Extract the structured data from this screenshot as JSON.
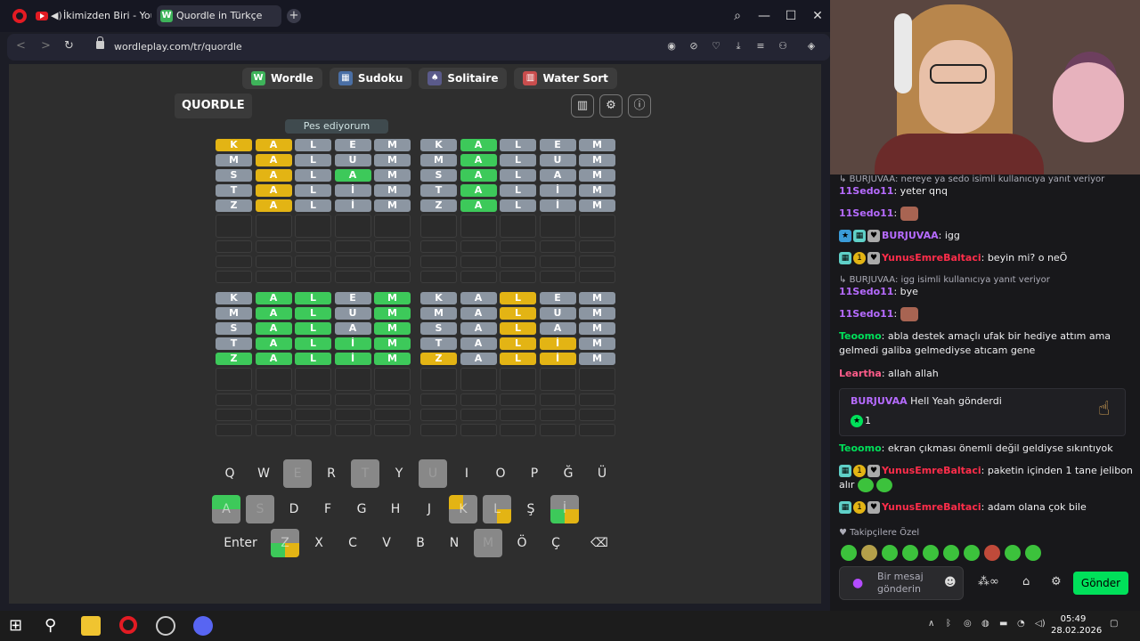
{
  "browser": {
    "tabs": [
      {
        "label": "İkimizden Biri - YouTube"
      },
      {
        "label": "Quordle in Türkçe"
      }
    ],
    "url": "wordleplay.com/tr/quordle"
  },
  "site_nav": [
    {
      "label": "Wordle",
      "icon": "wordle-icon",
      "color": "#3eb35a"
    },
    {
      "label": "Sudoku",
      "icon": "sudoku-grid-icon",
      "color": "#4a6fa5"
    },
    {
      "label": "Solitaire",
      "icon": "cards-icon",
      "color": "#5a5a8a"
    },
    {
      "label": "Water Sort",
      "icon": "tubes-icon",
      "color": "#c94d4d"
    }
  ],
  "game": {
    "title": "QUORDLE",
    "give_up": "Pes ediyorum",
    "boards": [
      {
        "rows": [
          [
            [
              "K",
              "y"
            ],
            [
              "A",
              "y"
            ],
            [
              "L",
              "x"
            ],
            [
              "E",
              "x"
            ],
            [
              "M",
              "x"
            ]
          ],
          [
            [
              "M",
              "x"
            ],
            [
              "A",
              "y"
            ],
            [
              "L",
              "x"
            ],
            [
              "U",
              "x"
            ],
            [
              "M",
              "x"
            ]
          ],
          [
            [
              "S",
              "x"
            ],
            [
              "A",
              "y"
            ],
            [
              "L",
              "x"
            ],
            [
              "A",
              "g"
            ],
            [
              "M",
              "x"
            ]
          ],
          [
            [
              "T",
              "x"
            ],
            [
              "A",
              "y"
            ],
            [
              "L",
              "x"
            ],
            [
              "İ",
              "x"
            ],
            [
              "M",
              "x"
            ]
          ],
          [
            [
              "Z",
              "x"
            ],
            [
              "A",
              "y"
            ],
            [
              "L",
              "x"
            ],
            [
              "İ",
              "x"
            ],
            [
              "M",
              "x"
            ]
          ]
        ]
      },
      {
        "rows": [
          [
            [
              "K",
              "x"
            ],
            [
              "A",
              "g"
            ],
            [
              "L",
              "x"
            ],
            [
              "E",
              "x"
            ],
            [
              "M",
              "x"
            ]
          ],
          [
            [
              "M",
              "x"
            ],
            [
              "A",
              "g"
            ],
            [
              "L",
              "x"
            ],
            [
              "U",
              "x"
            ],
            [
              "M",
              "x"
            ]
          ],
          [
            [
              "S",
              "x"
            ],
            [
              "A",
              "g"
            ],
            [
              "L",
              "x"
            ],
            [
              "A",
              "x"
            ],
            [
              "M",
              "x"
            ]
          ],
          [
            [
              "T",
              "x"
            ],
            [
              "A",
              "g"
            ],
            [
              "L",
              "x"
            ],
            [
              "İ",
              "x"
            ],
            [
              "M",
              "x"
            ]
          ],
          [
            [
              "Z",
              "x"
            ],
            [
              "A",
              "g"
            ],
            [
              "L",
              "x"
            ],
            [
              "İ",
              "x"
            ],
            [
              "M",
              "x"
            ]
          ]
        ]
      },
      {
        "rows": [
          [
            [
              "K",
              "x"
            ],
            [
              "A",
              "g"
            ],
            [
              "L",
              "g"
            ],
            [
              "E",
              "x"
            ],
            [
              "M",
              "g"
            ]
          ],
          [
            [
              "M",
              "x"
            ],
            [
              "A",
              "g"
            ],
            [
              "L",
              "g"
            ],
            [
              "U",
              "x"
            ],
            [
              "M",
              "g"
            ]
          ],
          [
            [
              "S",
              "x"
            ],
            [
              "A",
              "g"
            ],
            [
              "L",
              "g"
            ],
            [
              "A",
              "x"
            ],
            [
              "M",
              "g"
            ]
          ],
          [
            [
              "T",
              "x"
            ],
            [
              "A",
              "g"
            ],
            [
              "L",
              "g"
            ],
            [
              "İ",
              "g"
            ],
            [
              "M",
              "g"
            ]
          ],
          [
            [
              "Z",
              "g"
            ],
            [
              "A",
              "g"
            ],
            [
              "L",
              "g"
            ],
            [
              "İ",
              "g"
            ],
            [
              "M",
              "g"
            ]
          ]
        ]
      },
      {
        "rows": [
          [
            [
              "K",
              "x"
            ],
            [
              "A",
              "x"
            ],
            [
              "L",
              "y"
            ],
            [
              "E",
              "x"
            ],
            [
              "M",
              "x"
            ]
          ],
          [
            [
              "M",
              "x"
            ],
            [
              "A",
              "x"
            ],
            [
              "L",
              "y"
            ],
            [
              "U",
              "x"
            ],
            [
              "M",
              "x"
            ]
          ],
          [
            [
              "S",
              "x"
            ],
            [
              "A",
              "x"
            ],
            [
              "L",
              "y"
            ],
            [
              "A",
              "x"
            ],
            [
              "M",
              "x"
            ]
          ],
          [
            [
              "T",
              "x"
            ],
            [
              "A",
              "x"
            ],
            [
              "L",
              "y"
            ],
            [
              "İ",
              "y"
            ],
            [
              "M",
              "x"
            ]
          ],
          [
            [
              "Z",
              "y"
            ],
            [
              "A",
              "x"
            ],
            [
              "L",
              "y"
            ],
            [
              "İ",
              "y"
            ],
            [
              "M",
              "x"
            ]
          ]
        ]
      }
    ],
    "keyboard": {
      "row1": [
        "Q",
        "W",
        "E",
        "R",
        "T",
        "Y",
        "U",
        "I",
        "O",
        "P",
        "Ğ",
        "Ü"
      ],
      "row2": [
        "A",
        "S",
        "D",
        "F",
        "G",
        "H",
        "J",
        "K",
        "L",
        "Ş",
        "İ"
      ],
      "row3": [
        "Enter",
        "Z",
        "X",
        "C",
        "V",
        "B",
        "N",
        "M",
        "Ö",
        "Ç",
        "⌫"
      ],
      "used": [
        "E",
        "T",
        "U",
        "S",
        "M"
      ],
      "split_keys": {
        "A": [
          "#3dc95a",
          "#3dc95a",
          "#888",
          "#888"
        ],
        "K": [
          "#e3b414",
          "#888",
          "#888",
          "#888"
        ],
        "L": [
          "#888",
          "#888",
          "#888",
          "#e3b414"
        ],
        "İ": [
          "#888",
          "#888",
          "#3dc95a",
          "#e3b414"
        ],
        "Z": [
          "#888",
          "#888",
          "#3dc95a",
          "#e3b414"
        ]
      }
    }
  },
  "chat": {
    "messages": [
      {
        "reply": "BURJUVAA: nereye ya sedo isimli kullanıcıya yanıt veriyor"
      },
      {
        "user": "11Sedo11",
        "text": "yeter qnq"
      },
      {
        "user": "11Sedo11",
        "text": "",
        "emote": true
      },
      {
        "user": "BURJUVAA",
        "text": "igg"
      },
      {
        "user": "YunusEmreBaltaci",
        "text": "beyin mi? o neÖ"
      },
      {
        "reply": "BURJUVAA: igg isimli kullanıcıya yanıt veriyor"
      },
      {
        "user": "11Sedo11",
        "text": "bye"
      },
      {
        "user": "11Sedo11",
        "text": "",
        "emote": true
      },
      {
        "user": "Teoomo",
        "text": "abla destek amaçlı ufak bir hediye attım ama gelmedi galiba gelmediyse atıcam gene"
      },
      {
        "user": "Leartha",
        "text": "allah allah"
      },
      {
        "user": "Teoomo",
        "text": "ekran çıkması önemli değil geldiyse sıkıntıyok"
      },
      {
        "user": "YunusEmreBaltaci",
        "text": "paketin içinden 1 tane jelibon alır"
      },
      {
        "user": "YunusEmreBaltaci",
        "text": "adam olana çok bile"
      }
    ],
    "gift": {
      "user": "BURJUVAA",
      "text": "Hell Yeah gönderdi",
      "count": "1"
    },
    "followers_label": "Takipçilere Özel",
    "input_placeholder": "Bir mesaj gönderin",
    "send_label": "Gönder"
  },
  "taskbar": {
    "time": "05:49",
    "date": "28.02.2026"
  }
}
